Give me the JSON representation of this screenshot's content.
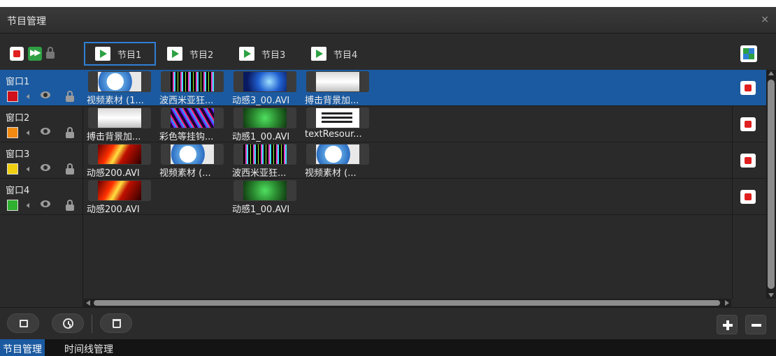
{
  "window": {
    "title": "节目管理",
    "close": "×"
  },
  "toolbar": {
    "record_icon": "record-icon",
    "play_all_icon": "fast-forward-icon",
    "lock_icon": "lock-icon",
    "programs": [
      {
        "label": "节目1",
        "active": true
      },
      {
        "label": "节目2",
        "active": false
      },
      {
        "label": "节目3",
        "active": false
      },
      {
        "label": "节目4",
        "active": false
      }
    ],
    "layout_icon": "layout-grid-icon"
  },
  "windows": [
    {
      "name": "窗口1",
      "color": "#d0101a",
      "selected": true,
      "clips": [
        {
          "label": "视频素材 (1...",
          "thumb": "t-video"
        },
        {
          "label": "波西米亚狂...",
          "thumb": "t-bars"
        },
        {
          "label": "动感3_00.AVI",
          "thumb": "t-blue"
        },
        {
          "label": "搏击背景加...",
          "thumb": "t-fight"
        }
      ]
    },
    {
      "name": "窗口2",
      "color": "#f08a10",
      "selected": false,
      "clips": [
        {
          "label": "搏击背景加...",
          "thumb": "t-fight"
        },
        {
          "label": "彩色等挂钩...",
          "thumb": "t-rainbow"
        },
        {
          "label": "动感1_00.AVI",
          "thumb": "t-green"
        },
        {
          "label": "textResour...",
          "thumb": "t-text"
        }
      ]
    },
    {
      "name": "窗口3",
      "color": "#f0d010",
      "selected": false,
      "clips": [
        {
          "label": "动感200.AVI",
          "thumb": "t-fire"
        },
        {
          "label": "视频素材 (...",
          "thumb": "t-video"
        },
        {
          "label": "波西米亚狂...",
          "thumb": "t-bars"
        },
        {
          "label": "视频素材 (...",
          "thumb": "t-video"
        }
      ]
    },
    {
      "name": "窗口4",
      "color": "#30b030",
      "selected": false,
      "clips": [
        {
          "label": "动感200.AVI",
          "thumb": "t-fire",
          "col": 0
        },
        {
          "label": "动感1_00.AVI",
          "thumb": "t-green",
          "col": 2
        }
      ]
    }
  ],
  "bottom": {
    "buttons": [
      "window-icon",
      "clock-icon",
      "trash-icon"
    ],
    "add_icon": "plus-icon",
    "remove_icon": "minus-icon"
  },
  "footer": {
    "tabs": [
      {
        "label": "节目管理",
        "active": true
      },
      {
        "label": "时间线管理",
        "active": false
      }
    ]
  }
}
